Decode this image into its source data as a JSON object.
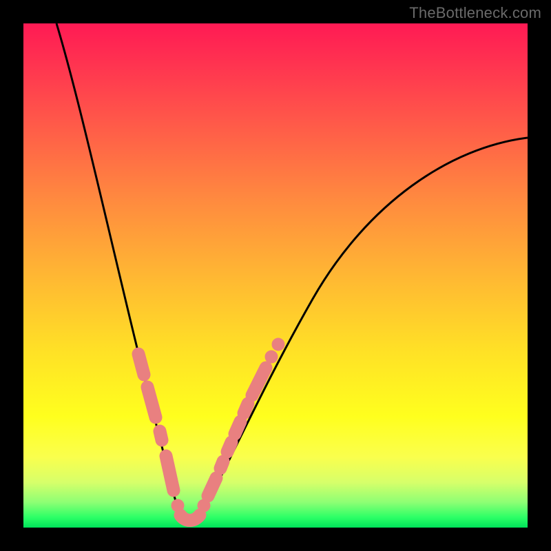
{
  "watermark": "TheBottleneck.com",
  "colors": {
    "background": "#000000",
    "gradient_top": "#ff1a54",
    "gradient_bottom": "#00e25a",
    "curve": "#000000",
    "marker": "#e98080"
  },
  "chart_data": {
    "type": "line",
    "title": "",
    "xlabel": "",
    "ylabel": "",
    "xlim": [
      0,
      100
    ],
    "ylim": [
      0,
      100
    ],
    "grid": false,
    "series": [
      {
        "name": "bottleneck-curve",
        "x": [
          6,
          8,
          10,
          12,
          14,
          16,
          18,
          20,
          22,
          24,
          26,
          28,
          29,
          30,
          31,
          32,
          33,
          34,
          36,
          38,
          42,
          46,
          50,
          55,
          60,
          65,
          70,
          75,
          80,
          85,
          90,
          95,
          100
        ],
        "y": [
          100,
          92,
          84,
          76,
          68,
          60,
          52,
          44,
          36,
          28,
          20,
          12,
          8,
          4,
          1,
          0,
          0.5,
          1.5,
          5,
          10,
          18,
          25,
          32,
          39,
          46,
          52,
          58,
          63,
          67,
          71,
          74,
          76.5,
          78
        ]
      }
    ],
    "markers": {
      "name": "highlight-dots",
      "color": "#e98080",
      "points": [
        {
          "x": 22.5,
          "y": 35
        },
        {
          "x": 23.5,
          "y": 31
        },
        {
          "x": 24.8,
          "y": 26
        },
        {
          "x": 26.5,
          "y": 18.5
        },
        {
          "x": 27.0,
          "y": 15.5
        },
        {
          "x": 28.5,
          "y": 10
        },
        {
          "x": 30.0,
          "y": 4
        },
        {
          "x": 31.0,
          "y": 1.5
        },
        {
          "x": 32.0,
          "y": 0.5
        },
        {
          "x": 33.0,
          "y": 0.5
        },
        {
          "x": 34.0,
          "y": 1.5
        },
        {
          "x": 35.5,
          "y": 4.5
        },
        {
          "x": 37.5,
          "y": 10
        },
        {
          "x": 38.5,
          "y": 13
        },
        {
          "x": 39.5,
          "y": 16
        },
        {
          "x": 40.5,
          "y": 19
        },
        {
          "x": 42.0,
          "y": 23
        },
        {
          "x": 43.0,
          "y": 26
        },
        {
          "x": 44.5,
          "y": 30
        },
        {
          "x": 46.0,
          "y": 34
        },
        {
          "x": 47.5,
          "y": 37.5
        }
      ]
    }
  }
}
